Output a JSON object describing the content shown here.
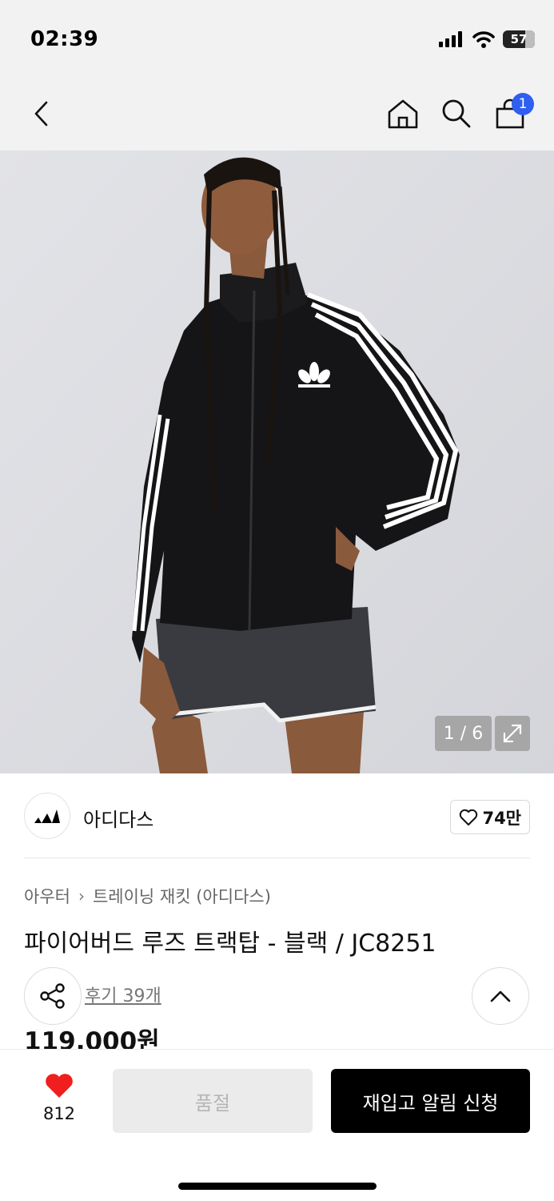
{
  "status_bar": {
    "time": "02:39",
    "battery": "57"
  },
  "nav": {
    "cart_count": "1"
  },
  "gallery": {
    "counter": "1 / 6"
  },
  "brand": {
    "name": "아디다스",
    "likes": "74만"
  },
  "breadcrumb": {
    "category": "아우터",
    "separator": "›",
    "subcategory": "트레이닝 재킷 (아디다스)"
  },
  "product": {
    "title": "파이어버드 루즈 트랙탑 - 블랙 / JC8251",
    "reviews": "후기 39개",
    "price": "119,000원"
  },
  "bottom_bar": {
    "wish_count": "812",
    "soldout_label": "품절",
    "restock_label": "재입고 알림 신청"
  },
  "colors": {
    "accent_badge": "#2f5ff0",
    "heart": "#f01e1e",
    "primary_button": "#000000"
  }
}
